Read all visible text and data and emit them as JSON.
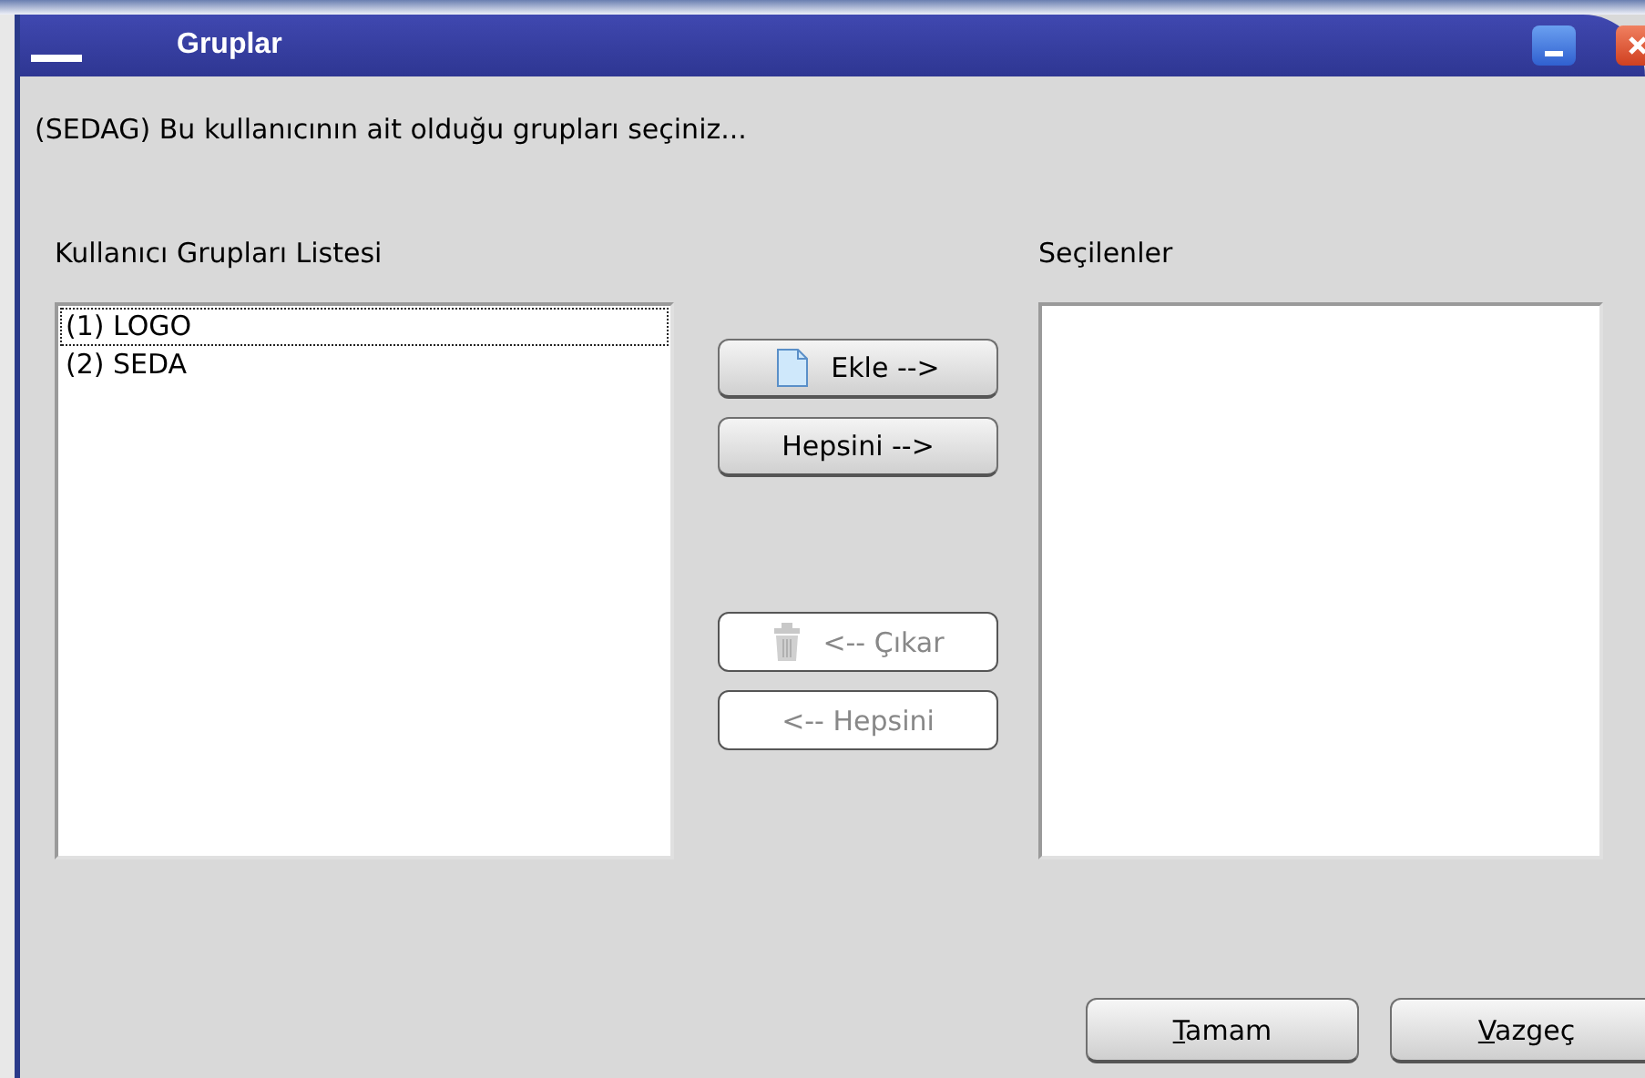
{
  "window": {
    "title": "Gruplar"
  },
  "instruction": "(SEDAG) Bu kullanıcının ait olduğu grupları seçiniz...",
  "available": {
    "label": "Kullanıcı Grupları Listesi",
    "items": [
      {
        "text": "(1) LOGO",
        "focused": true
      },
      {
        "text": "(2) SEDA",
        "focused": false
      }
    ]
  },
  "selected_list": {
    "label": "Seçilenler"
  },
  "move_buttons": [
    {
      "label": "Ekle -->",
      "kind": "add",
      "disabled": false
    },
    {
      "label": "Hepsini -->",
      "kind": "plain",
      "disabled": false
    },
    {
      "label": "<-- Çıkar",
      "kind": "remove",
      "disabled": true
    },
    {
      "label": "<-- Hepsini",
      "kind": "plain",
      "disabled": true
    }
  ],
  "buttons": [
    "Tamam",
    "Vazgeç"
  ]
}
